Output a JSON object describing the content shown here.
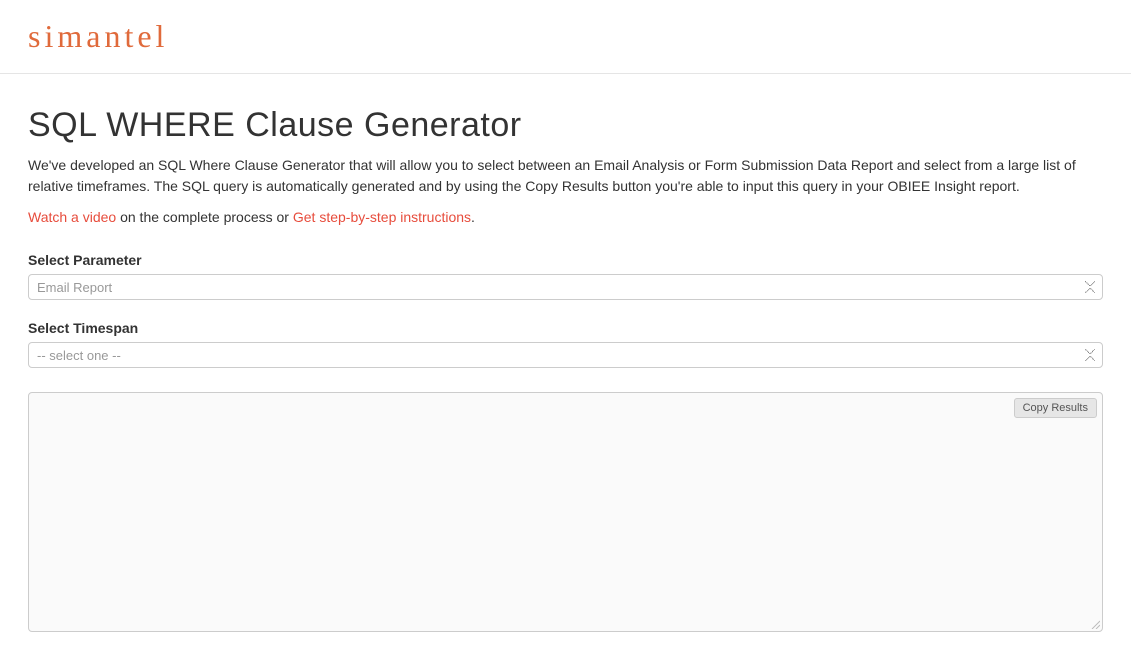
{
  "header": {
    "logo": "SIMANTEL"
  },
  "main": {
    "title": "SQL WHERE Clause Generator",
    "intro": "We've developed an SQL Where Clause Generator that will allow you to select between an Email Analysis or Form Submission Data Report and select from a large list of relative timeframes. The SQL query is automatically generated and by using the Copy Results button you're able to input this query in your OBIEE Insight report.",
    "secondary": {
      "link1": "Watch a video",
      "mid1": " on the complete process or ",
      "link2": "Get step-by-step instructions",
      "tail": "."
    }
  },
  "form": {
    "parameter": {
      "label": "Select Parameter",
      "selected": "Email Report"
    },
    "timespan": {
      "label": "Select Timespan",
      "selected": "-- select one --"
    }
  },
  "results": {
    "copy_label": "Copy Results",
    "value": ""
  }
}
